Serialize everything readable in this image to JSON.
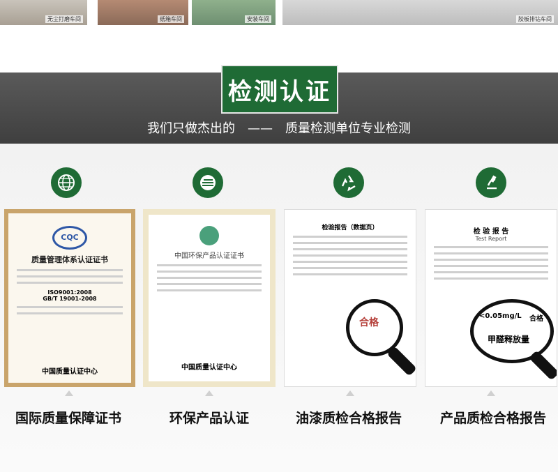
{
  "top_strip": {
    "captions": [
      "无尘打磨车间",
      "纸箱车间",
      "安装车间",
      "胶板排钻车间"
    ]
  },
  "section": {
    "title": "检测认证",
    "subtitle": "我们只做杰出的　——　质量检测单位专业检测"
  },
  "certificates": [
    {
      "label": "国际质量保障证书",
      "doc_title": "质量管理体系认证证书",
      "standard_1": "ISO9001:2008",
      "standard_2": "GB/T 19001-2008",
      "footer": "中国质量认证中心",
      "icon": "globe-icon"
    },
    {
      "label": "环保产品认证",
      "doc_title": "中国环保产品认证证书",
      "footer": "中国质量认证中心",
      "icon": "flag-icon"
    },
    {
      "label": "油漆质检合格报告",
      "doc_title": "检验报告（数据页）",
      "stamp_text": "合格",
      "icon": "recycle-icon"
    },
    {
      "label": "产品质检合格报告",
      "doc_title": "检 验 报 告",
      "doc_subtitle": "Test Report",
      "magnify_value": "<0.05mg/L",
      "magnify_result": "合格",
      "magnify_caption": "甲醛释放量",
      "icon": "microscope-icon"
    }
  ],
  "colors": {
    "brand_green": "#1f6b35",
    "hero_gray": "#4a4a4a"
  }
}
